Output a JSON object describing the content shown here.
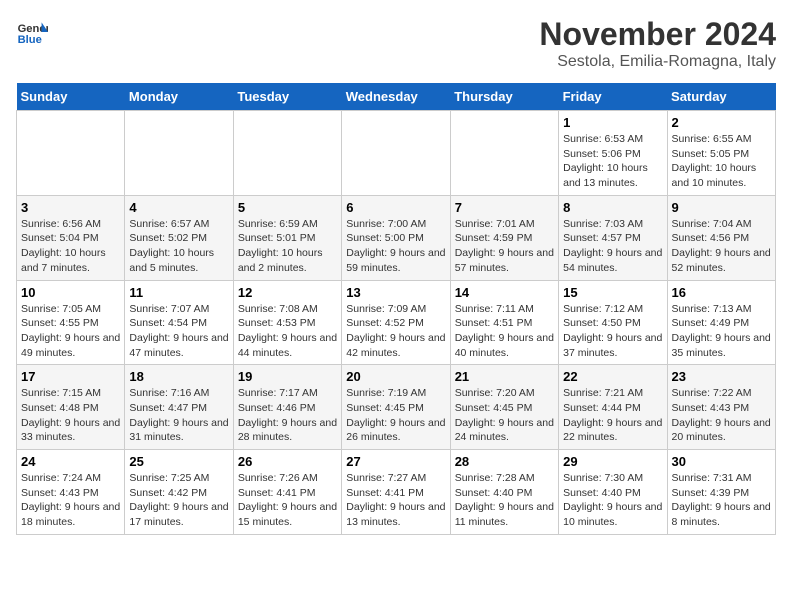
{
  "header": {
    "logo_line1": "General",
    "logo_line2": "Blue",
    "month": "November 2024",
    "location": "Sestola, Emilia-Romagna, Italy"
  },
  "weekdays": [
    "Sunday",
    "Monday",
    "Tuesday",
    "Wednesday",
    "Thursday",
    "Friday",
    "Saturday"
  ],
  "weeks": [
    [
      {
        "day": "",
        "info": ""
      },
      {
        "day": "",
        "info": ""
      },
      {
        "day": "",
        "info": ""
      },
      {
        "day": "",
        "info": ""
      },
      {
        "day": "",
        "info": ""
      },
      {
        "day": "1",
        "info": "Sunrise: 6:53 AM\nSunset: 5:06 PM\nDaylight: 10 hours and 13 minutes."
      },
      {
        "day": "2",
        "info": "Sunrise: 6:55 AM\nSunset: 5:05 PM\nDaylight: 10 hours and 10 minutes."
      }
    ],
    [
      {
        "day": "3",
        "info": "Sunrise: 6:56 AM\nSunset: 5:04 PM\nDaylight: 10 hours and 7 minutes."
      },
      {
        "day": "4",
        "info": "Sunrise: 6:57 AM\nSunset: 5:02 PM\nDaylight: 10 hours and 5 minutes."
      },
      {
        "day": "5",
        "info": "Sunrise: 6:59 AM\nSunset: 5:01 PM\nDaylight: 10 hours and 2 minutes."
      },
      {
        "day": "6",
        "info": "Sunrise: 7:00 AM\nSunset: 5:00 PM\nDaylight: 9 hours and 59 minutes."
      },
      {
        "day": "7",
        "info": "Sunrise: 7:01 AM\nSunset: 4:59 PM\nDaylight: 9 hours and 57 minutes."
      },
      {
        "day": "8",
        "info": "Sunrise: 7:03 AM\nSunset: 4:57 PM\nDaylight: 9 hours and 54 minutes."
      },
      {
        "day": "9",
        "info": "Sunrise: 7:04 AM\nSunset: 4:56 PM\nDaylight: 9 hours and 52 minutes."
      }
    ],
    [
      {
        "day": "10",
        "info": "Sunrise: 7:05 AM\nSunset: 4:55 PM\nDaylight: 9 hours and 49 minutes."
      },
      {
        "day": "11",
        "info": "Sunrise: 7:07 AM\nSunset: 4:54 PM\nDaylight: 9 hours and 47 minutes."
      },
      {
        "day": "12",
        "info": "Sunrise: 7:08 AM\nSunset: 4:53 PM\nDaylight: 9 hours and 44 minutes."
      },
      {
        "day": "13",
        "info": "Sunrise: 7:09 AM\nSunset: 4:52 PM\nDaylight: 9 hours and 42 minutes."
      },
      {
        "day": "14",
        "info": "Sunrise: 7:11 AM\nSunset: 4:51 PM\nDaylight: 9 hours and 40 minutes."
      },
      {
        "day": "15",
        "info": "Sunrise: 7:12 AM\nSunset: 4:50 PM\nDaylight: 9 hours and 37 minutes."
      },
      {
        "day": "16",
        "info": "Sunrise: 7:13 AM\nSunset: 4:49 PM\nDaylight: 9 hours and 35 minutes."
      }
    ],
    [
      {
        "day": "17",
        "info": "Sunrise: 7:15 AM\nSunset: 4:48 PM\nDaylight: 9 hours and 33 minutes."
      },
      {
        "day": "18",
        "info": "Sunrise: 7:16 AM\nSunset: 4:47 PM\nDaylight: 9 hours and 31 minutes."
      },
      {
        "day": "19",
        "info": "Sunrise: 7:17 AM\nSunset: 4:46 PM\nDaylight: 9 hours and 28 minutes."
      },
      {
        "day": "20",
        "info": "Sunrise: 7:19 AM\nSunset: 4:45 PM\nDaylight: 9 hours and 26 minutes."
      },
      {
        "day": "21",
        "info": "Sunrise: 7:20 AM\nSunset: 4:45 PM\nDaylight: 9 hours and 24 minutes."
      },
      {
        "day": "22",
        "info": "Sunrise: 7:21 AM\nSunset: 4:44 PM\nDaylight: 9 hours and 22 minutes."
      },
      {
        "day": "23",
        "info": "Sunrise: 7:22 AM\nSunset: 4:43 PM\nDaylight: 9 hours and 20 minutes."
      }
    ],
    [
      {
        "day": "24",
        "info": "Sunrise: 7:24 AM\nSunset: 4:43 PM\nDaylight: 9 hours and 18 minutes."
      },
      {
        "day": "25",
        "info": "Sunrise: 7:25 AM\nSunset: 4:42 PM\nDaylight: 9 hours and 17 minutes."
      },
      {
        "day": "26",
        "info": "Sunrise: 7:26 AM\nSunset: 4:41 PM\nDaylight: 9 hours and 15 minutes."
      },
      {
        "day": "27",
        "info": "Sunrise: 7:27 AM\nSunset: 4:41 PM\nDaylight: 9 hours and 13 minutes."
      },
      {
        "day": "28",
        "info": "Sunrise: 7:28 AM\nSunset: 4:40 PM\nDaylight: 9 hours and 11 minutes."
      },
      {
        "day": "29",
        "info": "Sunrise: 7:30 AM\nSunset: 4:40 PM\nDaylight: 9 hours and 10 minutes."
      },
      {
        "day": "30",
        "info": "Sunrise: 7:31 AM\nSunset: 4:39 PM\nDaylight: 9 hours and 8 minutes."
      }
    ]
  ]
}
